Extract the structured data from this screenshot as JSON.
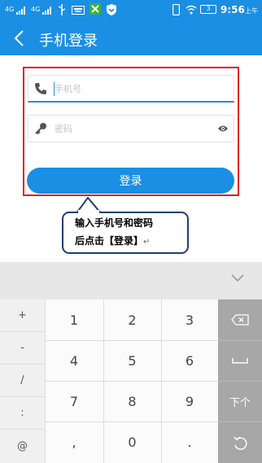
{
  "status_bar": {
    "signal_1": "4G",
    "signal_2": "4G",
    "battery": "3",
    "time": "9:56",
    "ampm": "上午"
  },
  "header": {
    "title": "手机登录",
    "back_icon": "back-chevron-icon"
  },
  "form": {
    "phone_placeholder": "手机号",
    "password_placeholder": "密码",
    "login_label": "登录",
    "phone_icon": "phone-icon",
    "key_icon": "key-icon",
    "eye_icon": "eye-icon"
  },
  "callout": {
    "line1": "输入手机号和密码",
    "line2": "后点击【登录】",
    "return_mark": "↵"
  },
  "keyboard": {
    "symbols": [
      "+",
      "-",
      "/",
      ":",
      "@"
    ],
    "numbers": [
      "1",
      "2",
      "3",
      "4",
      "5",
      "6",
      "7",
      "8",
      "9",
      ",",
      "0",
      "."
    ],
    "next_label": "下个",
    "collapse_icon": "chevron-down-icon",
    "backspace_icon": "backspace-icon",
    "space_icon": "space-icon",
    "enter_icon": "undo-enter-icon"
  },
  "colors": {
    "primary": "#1a8fe3",
    "highlight_border": "#e11b22",
    "callout_border": "#1f3f6f"
  }
}
